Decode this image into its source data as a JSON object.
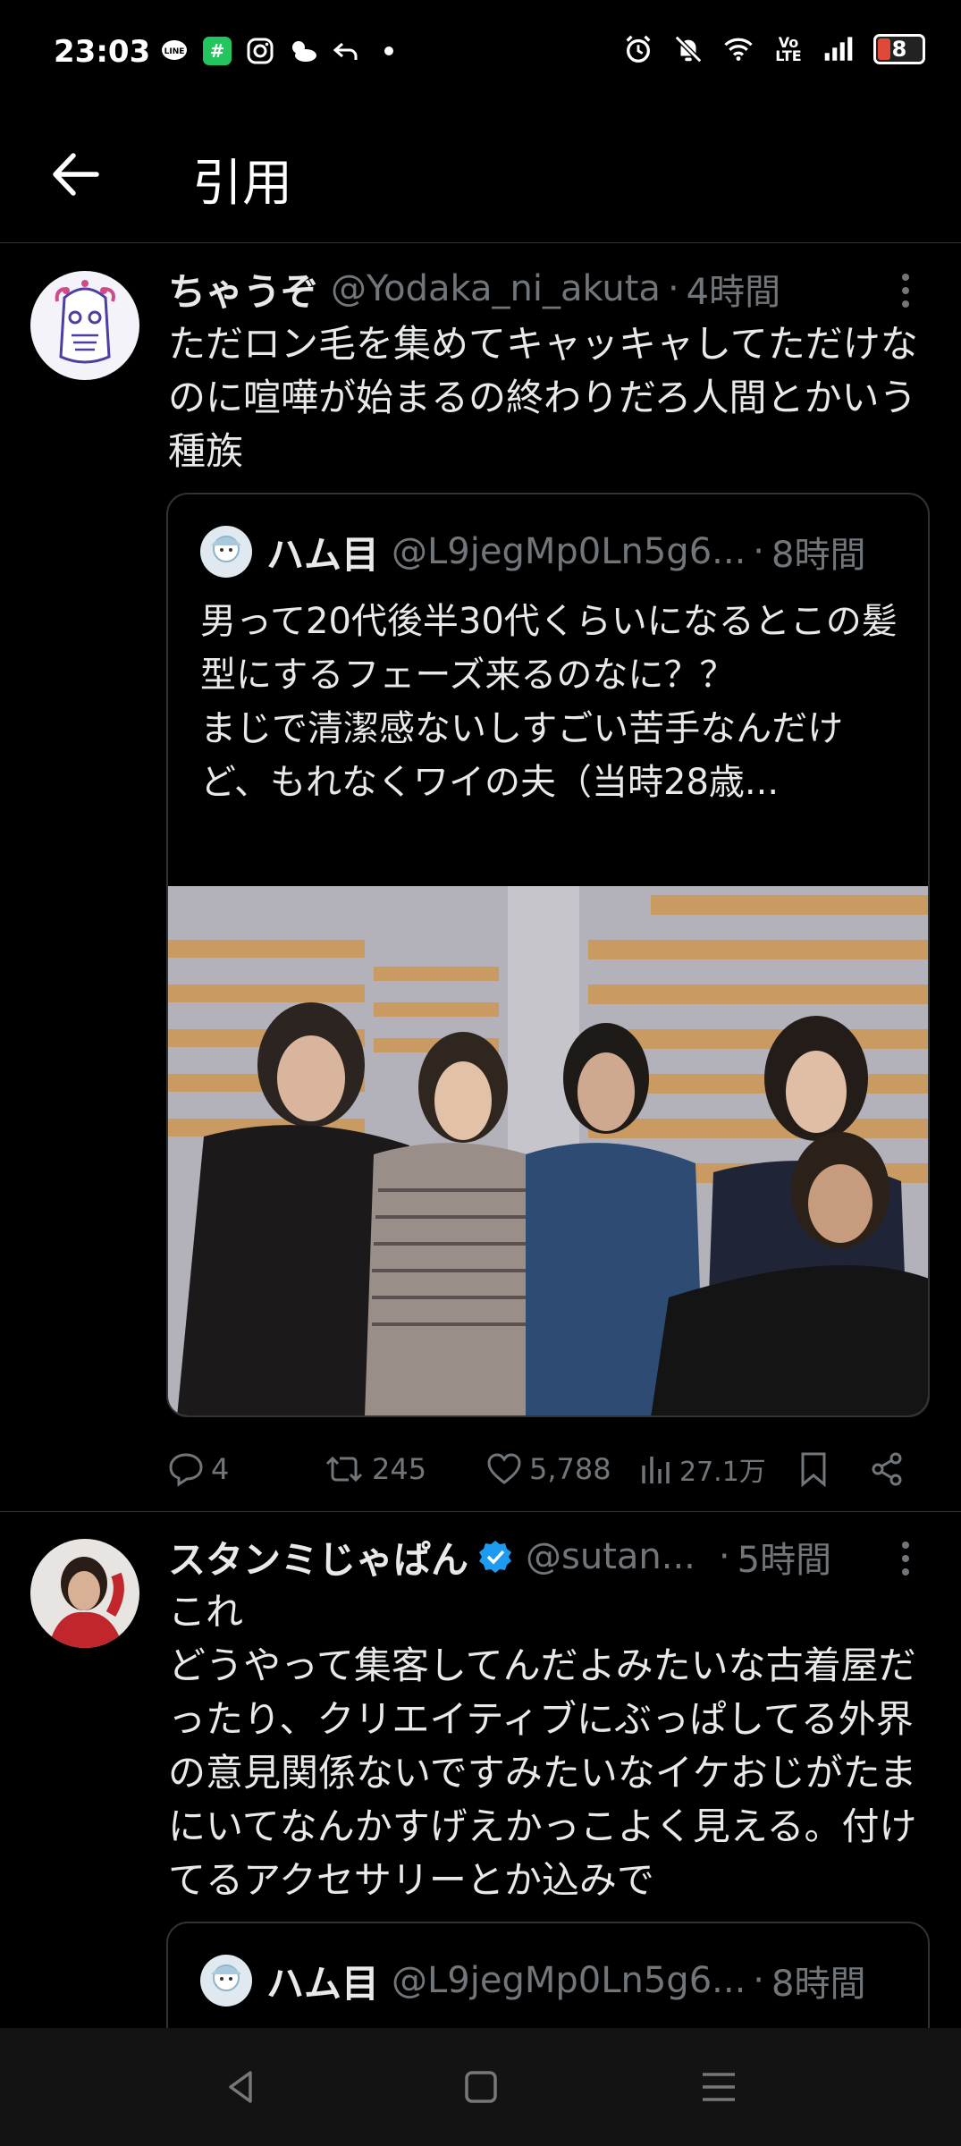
{
  "status_bar": {
    "time": "23:03",
    "battery_level": "8",
    "volte_label": "Vo\nLTE",
    "left_icons": [
      "line-icon",
      "chat-app-icon",
      "instagram-icon",
      "weather-icon",
      "reply-arrow-icon",
      "dot-icon"
    ],
    "right_icons": [
      "alarm-icon",
      "bell-off-icon",
      "wifi-icon",
      "volte-icon",
      "signal-icon",
      "battery-icon"
    ]
  },
  "header": {
    "title": "引用",
    "back_icon": "arrow-left-icon"
  },
  "tweets": [
    {
      "display_name": "ちゃうぞ",
      "handle": "@Yodaka_ni_akuta",
      "separator": "·",
      "time": "4時間",
      "text": "ただロン毛を集めてキャッキャしてただけなのに喧嘩が始まるの終わりだろ人間とかいう種族",
      "quote": {
        "display_name": "ハム目",
        "handle": "@L9jegMp0Ln5g6...",
        "separator": "·",
        "time": "8時間",
        "text": "男って20代後半30代くらいになるとこの髪型にするフェーズ来るのなに？？\nまじで清潔感ないしすごい苦手なんだけど、もれなくワイの夫（当時28歳..."
      },
      "actions": {
        "replies": "4",
        "retweets": "245",
        "likes": "5,788",
        "views": "27.1万"
      }
    },
    {
      "display_name": "スタンミじゃぱん",
      "handle": "@sutan...",
      "separator": "·",
      "time": "5時間",
      "text": "これ\nどうやって集客してんだよみたいな古着屋だったり、クリエイティブにぶっぱしてる外界の意見関係ないですみたいなイケおじがたまにいてなんかすげえかっこよく見える。付けてるアクセサリーとか込みで",
      "quote": {
        "display_name": "ハム目",
        "handle": "@L9jegMp0Ln5g6...",
        "separator": "·",
        "time": "8時間"
      }
    }
  ],
  "colors": {
    "background": "#000000",
    "text": "#e7e9ea",
    "secondary": "#71767b",
    "divider": "#2f3336",
    "verified": "#1d9bf0"
  }
}
